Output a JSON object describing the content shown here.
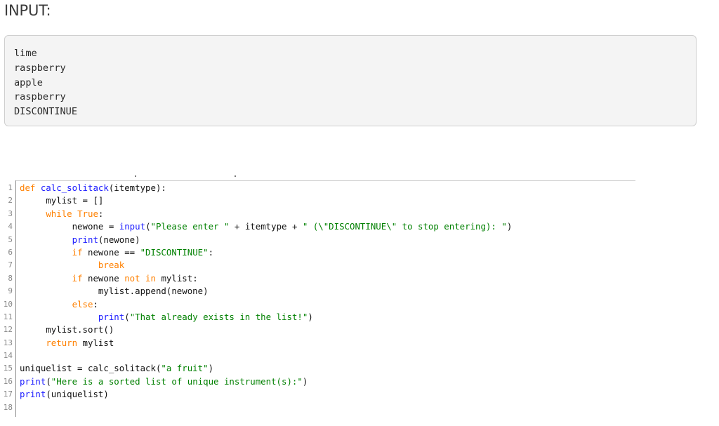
{
  "heading": "INPUT:",
  "input_lines": [
    "lime",
    "raspberry",
    "apple",
    "raspberry",
    "DISCONTINUE"
  ],
  "code": {
    "line_numbers": [
      "1",
      "2",
      "3",
      "4",
      "5",
      "6",
      "7",
      "8",
      "9",
      "10",
      "11",
      "12",
      "13",
      "14",
      "15",
      "16",
      "17",
      "18"
    ],
    "lines": [
      [
        {
          "t": "def ",
          "c": "kw"
        },
        {
          "t": "calc_solitack",
          "c": "kw-blue"
        },
        {
          "t": "(itemtype):",
          "c": "plain"
        }
      ],
      [
        {
          "t": "     mylist = []",
          "c": "plain"
        }
      ],
      [
        {
          "t": "     ",
          "c": "plain"
        },
        {
          "t": "while True",
          "c": "kw"
        },
        {
          "t": ":",
          "c": "plain"
        }
      ],
      [
        {
          "t": "          newone = ",
          "c": "plain"
        },
        {
          "t": "input",
          "c": "kw-blue"
        },
        {
          "t": "(",
          "c": "plain"
        },
        {
          "t": "\"Please enter \"",
          "c": "str2"
        },
        {
          "t": " + itemtype + ",
          "c": "plain"
        },
        {
          "t": "\" (\\\"DISCONTINUE\\\" to stop entering): \"",
          "c": "str2"
        },
        {
          "t": ")",
          "c": "plain"
        }
      ],
      [
        {
          "t": "          ",
          "c": "plain"
        },
        {
          "t": "print",
          "c": "kw-blue"
        },
        {
          "t": "(newone)",
          "c": "plain"
        }
      ],
      [
        {
          "t": "          ",
          "c": "plain"
        },
        {
          "t": "if",
          "c": "kw"
        },
        {
          "t": " newone == ",
          "c": "plain"
        },
        {
          "t": "\"DISCONTINUE\"",
          "c": "str2"
        },
        {
          "t": ":",
          "c": "plain"
        }
      ],
      [
        {
          "t": "               ",
          "c": "plain"
        },
        {
          "t": "break",
          "c": "kw"
        }
      ],
      [
        {
          "t": "          ",
          "c": "plain"
        },
        {
          "t": "if",
          "c": "kw"
        },
        {
          "t": " newone ",
          "c": "plain"
        },
        {
          "t": "not in",
          "c": "kw"
        },
        {
          "t": " mylist:",
          "c": "plain"
        }
      ],
      [
        {
          "t": "               mylist.append(newone)",
          "c": "plain"
        }
      ],
      [
        {
          "t": "          ",
          "c": "plain"
        },
        {
          "t": "else",
          "c": "kw"
        },
        {
          "t": ":",
          "c": "plain"
        }
      ],
      [
        {
          "t": "               ",
          "c": "plain"
        },
        {
          "t": "print",
          "c": "kw-blue"
        },
        {
          "t": "(",
          "c": "plain"
        },
        {
          "t": "\"That already exists in the list!\"",
          "c": "str2"
        },
        {
          "t": ")",
          "c": "plain"
        }
      ],
      [
        {
          "t": "     mylist.sort()",
          "c": "plain"
        }
      ],
      [
        {
          "t": "     ",
          "c": "plain"
        },
        {
          "t": "return",
          "c": "kw"
        },
        {
          "t": " mylist",
          "c": "plain"
        }
      ],
      [
        {
          "t": "",
          "c": "plain"
        }
      ],
      [
        {
          "t": "uniquelist = calc_solitack(",
          "c": "plain"
        },
        {
          "t": "\"a fruit\"",
          "c": "str2"
        },
        {
          "t": ")",
          "c": "plain"
        }
      ],
      [
        {
          "t": "print",
          "c": "kw-blue"
        },
        {
          "t": "(",
          "c": "plain"
        },
        {
          "t": "\"Here is a sorted list of unique instrument(s):\"",
          "c": "str2"
        },
        {
          "t": ")",
          "c": "plain"
        }
      ],
      [
        {
          "t": "print",
          "c": "kw-blue"
        },
        {
          "t": "(uniquelist)",
          "c": "plain"
        }
      ],
      [
        {
          "t": "",
          "c": "plain"
        }
      ]
    ]
  }
}
